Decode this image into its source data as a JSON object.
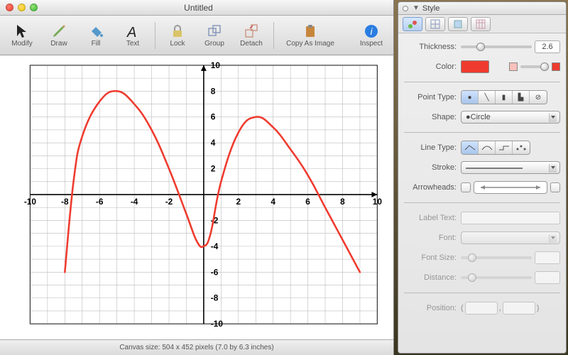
{
  "window": {
    "title": "Untitled"
  },
  "toolbar": {
    "modify": "Modify",
    "draw": "Draw",
    "fill": "Fill",
    "text": "Text",
    "lock": "Lock",
    "group": "Group",
    "detach": "Detach",
    "copy_as_image": "Copy As Image",
    "inspect": "Inspect"
  },
  "status": {
    "text": "Canvas size:  504 x 452 pixels (7.0 by 6.3 inches)"
  },
  "panel": {
    "title": "Style",
    "thickness_label": "Thickness:",
    "thickness_value": "2.6",
    "color_label": "Color:",
    "color_hex": "#ef3b2f",
    "point_type_label": "Point Type:",
    "shape_label": "Shape:",
    "shape_value": "Circle",
    "line_type_label": "Line Type:",
    "stroke_label": "Stroke:",
    "arrowheads_label": "Arrowheads:",
    "label_text_label": "Label Text:",
    "font_label": "Font:",
    "font_size_label": "Font Size:",
    "distance_label": "Distance:",
    "position_label": "Position:",
    "paren_open": "(",
    "paren_close": ")",
    "comma": ","
  },
  "chart_data": {
    "type": "line",
    "title": "",
    "xlabel": "",
    "ylabel": "",
    "xlim": [
      -10,
      10
    ],
    "ylim": [
      -10,
      10
    ],
    "x_ticks": [
      -10,
      -8,
      -6,
      -4,
      -2,
      2,
      4,
      6,
      8,
      10
    ],
    "y_ticks": [
      -10,
      -8,
      -6,
      -4,
      -2,
      2,
      4,
      6,
      8,
      10
    ],
    "grid": true,
    "series": [
      {
        "name": "curve",
        "color": "#ef3b2f",
        "points": [
          {
            "x": -8.0,
            "y": -6.0
          },
          {
            "x": -7.5,
            "y": 1.0
          },
          {
            "x": -7.0,
            "y": 4.5
          },
          {
            "x": -6.0,
            "y": 7.2
          },
          {
            "x": -5.0,
            "y": 8.0
          },
          {
            "x": -4.0,
            "y": 7.0
          },
          {
            "x": -3.0,
            "y": 5.0
          },
          {
            "x": -2.0,
            "y": 2.0
          },
          {
            "x": -1.0,
            "y": -1.5
          },
          {
            "x": -0.4,
            "y": -3.6
          },
          {
            "x": 0.0,
            "y": -4.0
          },
          {
            "x": 0.4,
            "y": -3.0
          },
          {
            "x": 1.0,
            "y": 1.0
          },
          {
            "x": 2.0,
            "y": 4.8
          },
          {
            "x": 3.0,
            "y": 6.0
          },
          {
            "x": 4.0,
            "y": 5.2
          },
          {
            "x": 5.0,
            "y": 3.5
          },
          {
            "x": 6.0,
            "y": 1.5
          },
          {
            "x": 7.0,
            "y": -1.0
          },
          {
            "x": 8.0,
            "y": -3.5
          },
          {
            "x": 9.0,
            "y": -6.0
          }
        ]
      }
    ]
  }
}
